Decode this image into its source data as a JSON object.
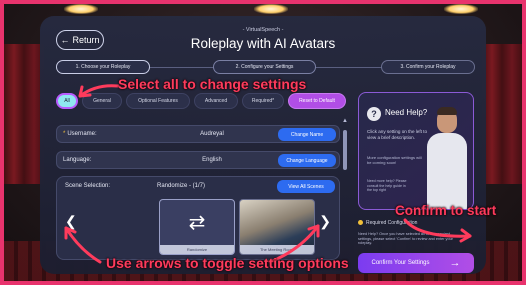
{
  "header": {
    "return_label": "Return",
    "brand": "- VirtualSpeech -",
    "title": "Roleplay with AI Avatars"
  },
  "steps": [
    {
      "label": "1. Choose your Roleplay"
    },
    {
      "label": "2. Configure your Settings"
    },
    {
      "label": "3. Confirm your Roleplay"
    }
  ],
  "tabs": {
    "all": "All",
    "general": "General",
    "optional": "Optional Features",
    "advanced": "Advanced",
    "required": "Required*",
    "reset": "Reset to Default"
  },
  "fields": {
    "username_label": "Username:",
    "username_value": "Audreyal",
    "username_button": "Change Name",
    "language_label": "Language:",
    "language_value": "English",
    "language_button": "Change Language"
  },
  "scene": {
    "label": "Scene Selection:",
    "value": "Randomize - (1/7)",
    "button": "View All Scenes",
    "thumb1_caption": "Randomize",
    "thumb2_caption": "The Meeting Room"
  },
  "help": {
    "title": "Need Help?",
    "text1": "Click any setting on the left to view a brief description.",
    "text2": "More configuration settings will be coming soon!",
    "text3": "Need more help? Please consult the help guide in the top right"
  },
  "required": {
    "label": "Required Configuration",
    "note": "Need Help? Once you have selected all of the required settings, please select 'Confirm' to review and enter your roleplay."
  },
  "confirm_label": "Confirm Your Settings",
  "annotations": {
    "select_all": "Select all to change settings",
    "confirm": "Confirm to start",
    "arrows": "Use arrows to toggle setting options"
  },
  "colors": {
    "border": "#e8336d",
    "accent_blue": "#2d6bf0",
    "accent_purple": "#b14ee6",
    "annotation": "#ff3b5c"
  }
}
